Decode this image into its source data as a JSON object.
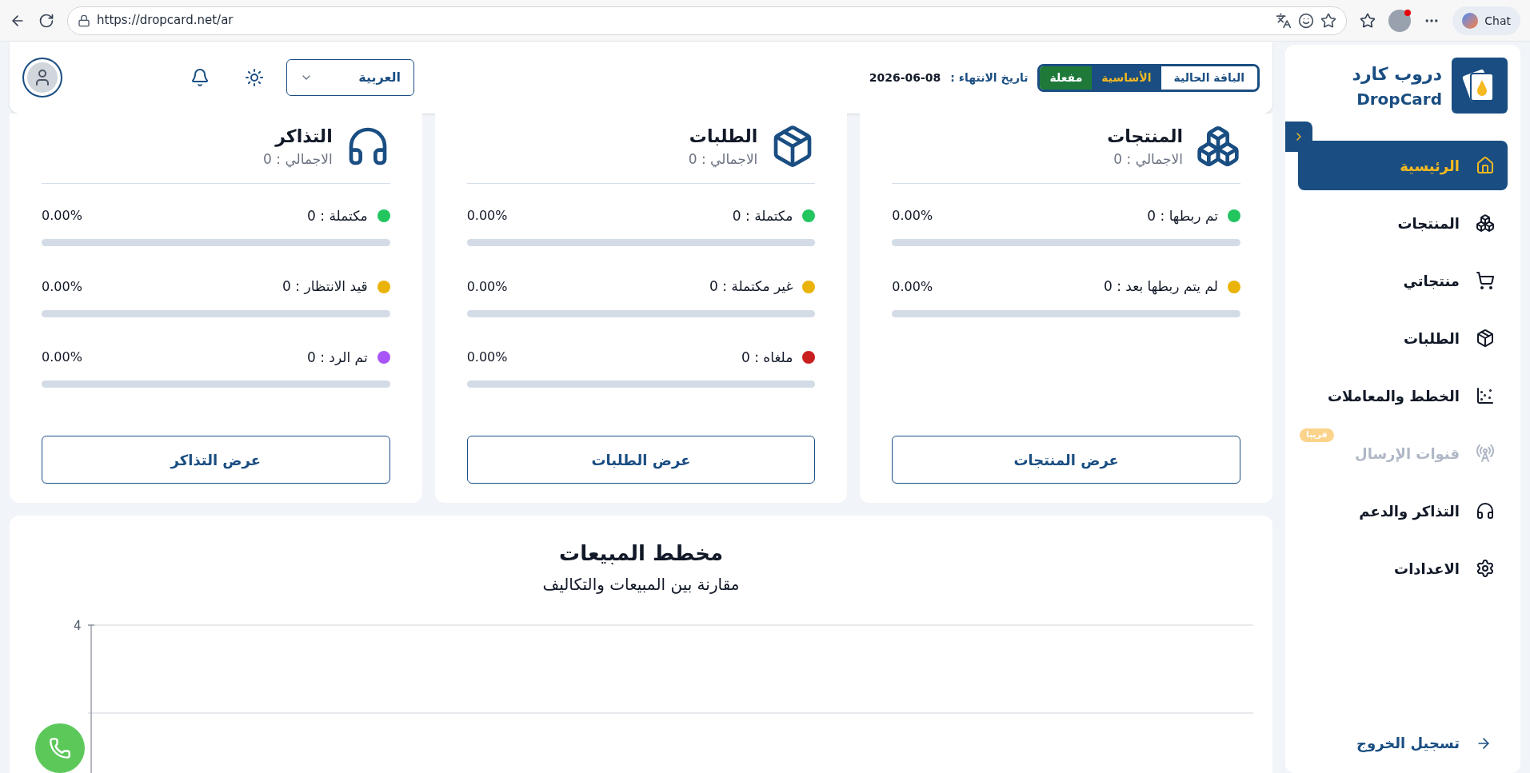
{
  "browser": {
    "url": "https://dropcard.net/ar",
    "chat_label": "Chat"
  },
  "sidebar": {
    "brand_ar": "دروب كارد",
    "brand_en": "DropCard",
    "items": [
      {
        "label": "الرئيسية",
        "kind": "home",
        "selected": true,
        "disabled": false
      },
      {
        "label": "المنتجات",
        "kind": "boxes",
        "selected": false,
        "disabled": false
      },
      {
        "label": "منتجاتي",
        "kind": "cart",
        "selected": false,
        "disabled": false
      },
      {
        "label": "الطلبات",
        "kind": "package",
        "selected": false,
        "disabled": false
      },
      {
        "label": "الخطط والمعاملات",
        "kind": "plans",
        "selected": false,
        "disabled": false
      },
      {
        "label": "قنوات الإرسال",
        "kind": "radio",
        "selected": false,
        "disabled": true,
        "badge": "قريبا"
      },
      {
        "label": "التذاكر والدعم",
        "kind": "headset",
        "selected": false,
        "disabled": false
      },
      {
        "label": "الاعدادات",
        "kind": "settings",
        "selected": false,
        "disabled": false
      }
    ],
    "logout": "تسجيل الخروج"
  },
  "header": {
    "plan_label": "الباقة الحالية",
    "plan_name": "الأساسية",
    "plan_status": "مفعلة",
    "expiry_label": "تاريخ الانتهاء :",
    "expiry_date": "2026-06-08",
    "language": "العربية"
  },
  "cards": [
    {
      "title": "المنتجات",
      "kind": "boxes",
      "total": "الاجمالي : 0",
      "stats": [
        {
          "label": "تم ربطها : 0",
          "percent": "0.00%",
          "level": 0,
          "color": "#22c55e"
        },
        {
          "label": "لم يتم ربطها بعد : 0",
          "percent": "0.00%",
          "level": 0,
          "color": "#eab308"
        }
      ],
      "button": "عرض المنتجات"
    },
    {
      "title": "الطلبات",
      "kind": "package",
      "total": "الاجمالي : 0",
      "stats": [
        {
          "label": "مكتملة : 0",
          "percent": "0.00%",
          "level": 0,
          "color": "#22c55e"
        },
        {
          "label": "غير مكتملة : 0",
          "percent": "0.00%",
          "level": 0,
          "color": "#eab308"
        },
        {
          "label": "ملغاه : 0",
          "percent": "0.00%",
          "level": 0,
          "color": "#c81e1e"
        }
      ],
      "button": "عرض الطلبات"
    },
    {
      "title": "التذاكر",
      "kind": "headset",
      "total": "الاجمالي : 0",
      "stats": [
        {
          "label": "مكتملة : 0",
          "percent": "0.00%",
          "level": 0,
          "color": "#22c55e"
        },
        {
          "label": "قيد الانتظار : 0",
          "percent": "0.00%",
          "level": 0,
          "color": "#eab308"
        },
        {
          "label": "تم الرد : 0",
          "percent": "0.00%",
          "level": 0,
          "color": "#a855f7"
        }
      ],
      "button": "عرض التذاكر"
    }
  ],
  "sales_chart": {
    "title": "مخطط المبيعات",
    "subtitle": "مقارنة بين المبيعات والتكاليف",
    "y_tick": "4"
  }
}
